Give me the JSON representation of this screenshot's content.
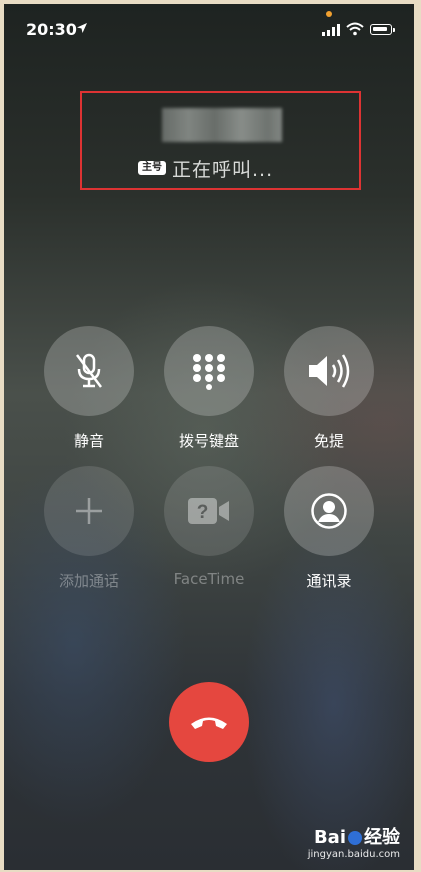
{
  "status_bar": {
    "time": "20:30",
    "icons": [
      "location-arrow-icon",
      "signal-icon",
      "wifi-icon",
      "battery-icon"
    ]
  },
  "caller": {
    "sim_badge": "主号",
    "status": "正在呼叫..."
  },
  "controls": {
    "mute_label": "静音",
    "keypad_label": "拨号键盘",
    "speaker_label": "免提",
    "add_call_label": "添加通话",
    "facetime_label": "FaceTime",
    "contacts_label": "通讯录"
  },
  "watermark": {
    "brand": "Bai",
    "brand_suffix": "经验",
    "url": "jingyan.baidu.com"
  },
  "colors": {
    "end_call": "#e5473f",
    "highlight_box": "#dd3333"
  }
}
